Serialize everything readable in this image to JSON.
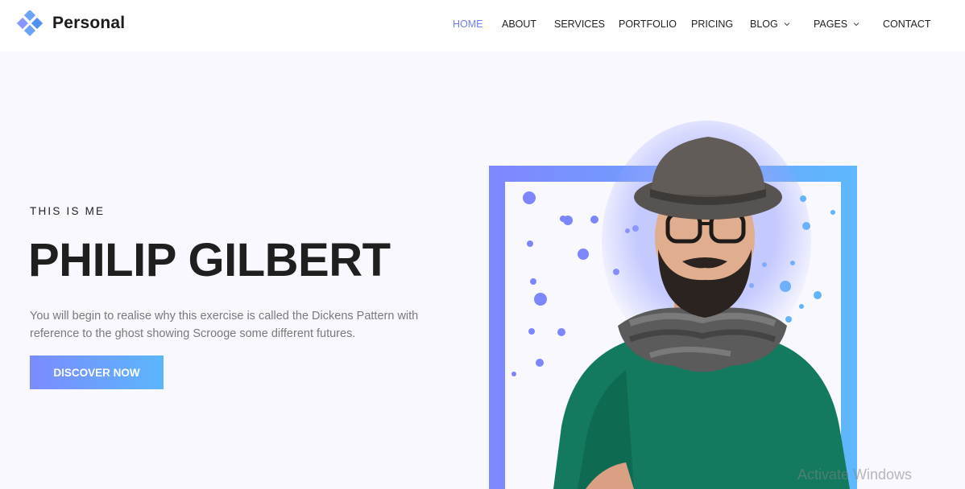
{
  "brand": {
    "name": "Personal",
    "logo_icon": "diamond-cluster-logo",
    "logo_color": "#6aa3f8"
  },
  "nav": {
    "items": [
      {
        "label": "HOME",
        "active": true
      },
      {
        "label": "ABOUT"
      },
      {
        "label": "SERVICES"
      },
      {
        "label": "PORTFOLIO"
      },
      {
        "label": "PRICING"
      },
      {
        "label": "BLOG",
        "has_dropdown": true
      },
      {
        "label": "PAGES",
        "has_dropdown": true
      },
      {
        "label": "CONTACT"
      }
    ],
    "active_color": "#6e7df4"
  },
  "hero": {
    "eyebrow": "THIS IS ME",
    "title": "PHILIP GILBERT",
    "description": "You will begin to realise why this exercise is called the Dickens Pattern with reference to the ghost showing Scrooge some different futures.",
    "cta_label": "DISCOVER NOW",
    "gradient": [
      "#7b8bff",
      "#5bb6fb"
    ],
    "image": "portrait of bearded man in hat, glasses, scarf and green sweater"
  },
  "watermark": "Activate Windows"
}
